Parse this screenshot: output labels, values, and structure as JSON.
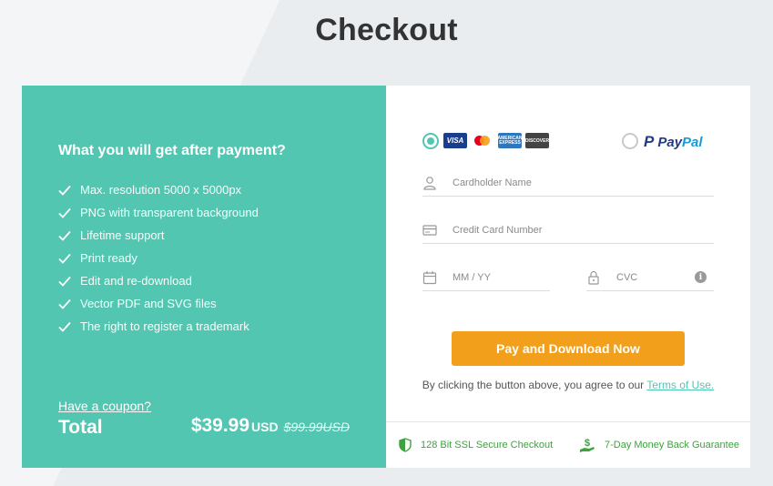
{
  "page": {
    "title": "Checkout"
  },
  "summary": {
    "heading": "What you will get after payment?",
    "features": [
      "Max. resolution 5000 x 5000px",
      "PNG with transparent background",
      "Lifetime support",
      "Print ready",
      "Edit and re-download",
      "Vector PDF and SVG files",
      "The right to register a trademark"
    ],
    "coupon_link": "Have a coupon?",
    "total_label": "Total",
    "price": "$39.99",
    "currency": "USD",
    "old_price": "$99.99USD"
  },
  "payment": {
    "methods": [
      {
        "name": "card",
        "selected": true,
        "logos": [
          "VISA",
          "mastercard",
          "AMERICAN EXPRESS",
          "DISCOVER"
        ]
      },
      {
        "name": "PayPal",
        "selected": false
      }
    ],
    "paypal_pay": "Pay",
    "paypal_pal": "Pal",
    "fields": {
      "cardholder": {
        "placeholder": "Cardholder Name",
        "value": ""
      },
      "card_number": {
        "placeholder": "Credit Card Number",
        "value": ""
      },
      "expiry": {
        "placeholder": "MM / YY",
        "value": ""
      },
      "cvc": {
        "placeholder": "CVC",
        "value": ""
      }
    },
    "button_label": "Pay and Download Now",
    "agree_text": "By clicking the button above, you agree to our ",
    "terms_link": "Terms of Use.",
    "badges": {
      "ssl": "128 Bit SSL Secure Checkout",
      "guarantee": "7-Day Money Back Guarantee"
    }
  },
  "colors": {
    "accent": "#52c6b1",
    "button": "#f29f1c",
    "badge_green": "#3da33d",
    "paypal_dark": "#253b80",
    "paypal_light": "#179bd7"
  },
  "icons": [
    "check-icon",
    "user-icon",
    "credit-card-icon",
    "calendar-icon",
    "lock-icon",
    "info-icon",
    "shield-icon",
    "money-hand-icon"
  ]
}
